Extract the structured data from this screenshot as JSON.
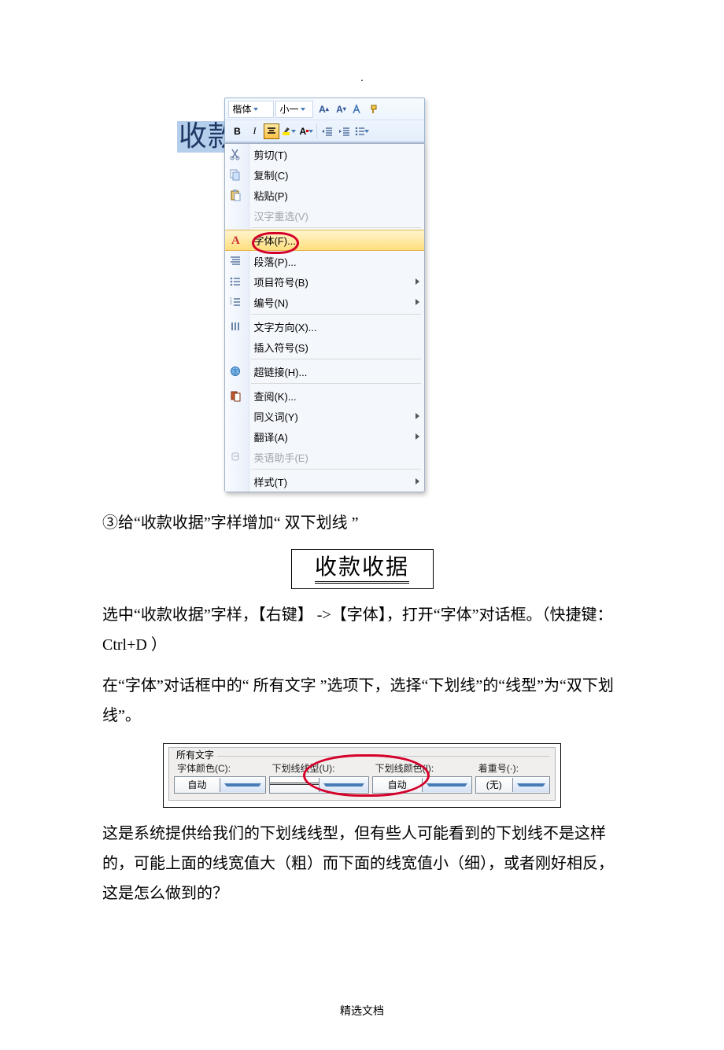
{
  "selected_text": "收款",
  "mini_toolbar": {
    "font_name": "楷体",
    "font_size": "小一"
  },
  "context_menu": {
    "cut": "剪切(T)",
    "copy": "复制(C)",
    "paste": "粘贴(P)",
    "reconvert": "汉字重选(V)",
    "font": "字体(F)...",
    "paragraph": "段落(P)...",
    "bullets": "项目符号(B)",
    "numbering": "编号(N)",
    "text_direction": "文字方向(X)...",
    "insert_symbol": "插入符号(S)",
    "hyperlink": "超链接(H)...",
    "lookup": "查阅(K)...",
    "synonyms": "同义词(Y)",
    "translate": "翻译(A)",
    "english_asst": "英语助手(E)",
    "styles": "样式(T)"
  },
  "step_text": "③给“收款收据”字样增加“ 双下划线 ”",
  "receipt_sample": "收款收据",
  "paragraph1": "选中“收款收据”字样，【右键】 ->【字体】，打开“字体”对话框。（快捷键： Ctrl+D ）",
  "paragraph2": "在“字体”对话框中的“ 所有文字 ”选项下，选择“下划线”的“线型”为“双下划线”。",
  "font_dialog": {
    "group": "所有文字",
    "color_label": "字体颜色(C):",
    "color_value": "自动",
    "uline_label": "下划线线型(U):",
    "uline_color_label": "下划线颜色(I):",
    "uline_color_value": "自动",
    "emph_label": "着重号(·):",
    "emph_value": "(无)"
  },
  "paragraph3": "这是系统提供给我们的下划线线型，但有些人可能看到的下划线不是这样的，可能上面的线宽值大（粗）而下面的线宽值小（细），或者刚好相反，这是怎么做到的？",
  "footer": "精选文档",
  "top_dot": "."
}
